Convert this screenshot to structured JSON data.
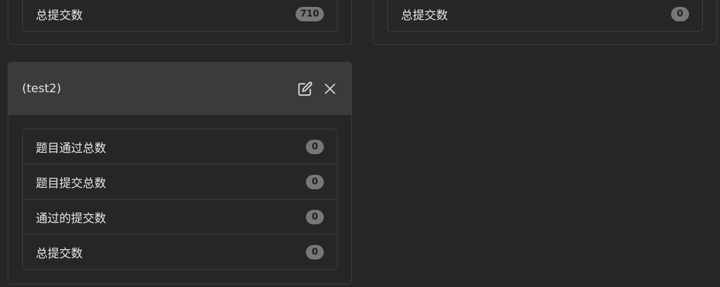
{
  "cards": [
    {
      "items": [
        {
          "label": "总提交数",
          "count": "710"
        }
      ]
    },
    {
      "items": [
        {
          "label": "总提交数",
          "count": "0"
        }
      ]
    },
    {
      "title": "(test2)",
      "actions": {
        "edit_icon": "edit-icon",
        "close_icon": "close-icon"
      },
      "items": [
        {
          "label": "题目通过总数",
          "count": "0"
        },
        {
          "label": "题目提交总数",
          "count": "0"
        },
        {
          "label": "通过的提交数",
          "count": "0"
        },
        {
          "label": "总提交数",
          "count": "0"
        }
      ]
    }
  ]
}
